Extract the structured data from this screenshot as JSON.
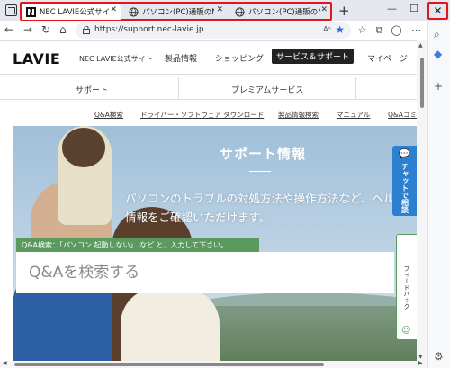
{
  "browser": {
    "tabs": [
      {
        "title": "NEC LAVIE公式サイト > サポート",
        "active": true
      },
      {
        "title": "パソコン(PC)通販のNEC LAVIE",
        "active": false
      },
      {
        "title": "パソコン(PC)通販のNEC LAVIE",
        "active": false
      }
    ],
    "new_tab_icon": "+",
    "minimize_icon": "—",
    "maximize_icon": "☐",
    "close_icon": "✕",
    "url": "https://support.nec-lavie.jp",
    "read_aloud_label": "Aᴬ",
    "highlight_color": "#e4141c"
  },
  "site": {
    "logo": "LAVIE",
    "logo_sub": "NEC LAVIE公式サイト",
    "top_nav": [
      "製品情報",
      "ショッピング",
      "サービス＆サポート",
      "マイページ"
    ],
    "sub_nav": [
      "サポート",
      "プレミアムサービス"
    ],
    "links": [
      "Q&A検索",
      "ドライバー・ソフトウェア ダウンロード",
      "製品情報検索",
      "マニュアル",
      "Q&Aコミュ"
    ],
    "hero": {
      "title": "サポート情報",
      "text": "パソコンのトラブルの対処方法や操作方法など、ヘルプ情報をご確認いただけます。",
      "qa_label": "Q&A検索：「パソコン 起動しない」 など と、入力して下さい。",
      "qa_placeholder": "Q&Aを検索する"
    },
    "chat_tab": "チャットで相談",
    "feedback_tab": "フィードバック",
    "accent_green": "#5b9a5e",
    "accent_blue": "#2d7fd0"
  },
  "sidebar": {
    "items": [
      "search",
      "copilot",
      "add",
      "settings"
    ]
  }
}
